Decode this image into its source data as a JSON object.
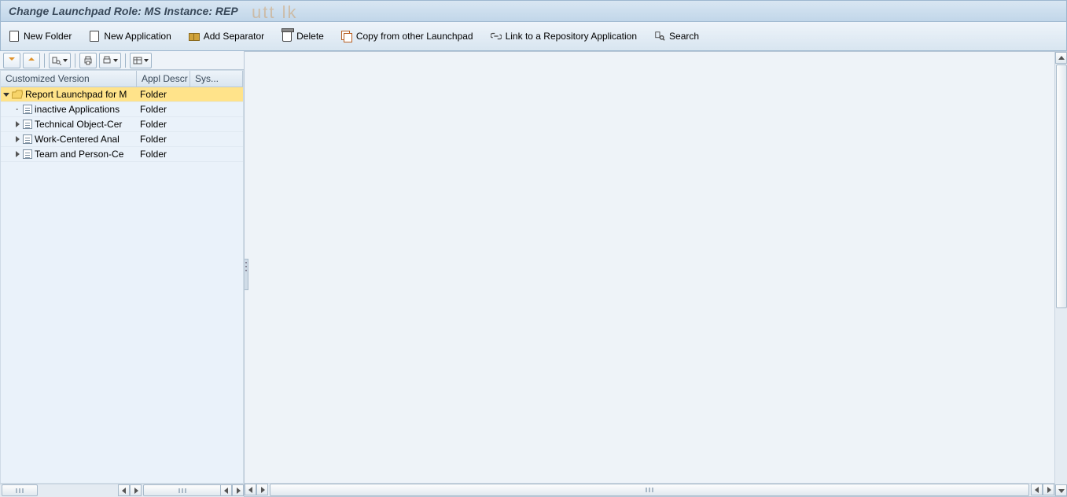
{
  "title": "Change Launchpad Role: MS Instance: REP",
  "toolbar": {
    "newFolder": "New Folder",
    "newApplication": "New Application",
    "addSeparator": "Add Separator",
    "delete": "Delete",
    "copyFrom": "Copy from other Launchpad",
    "linkRepo": "Link to a Repository Application",
    "search": "Search"
  },
  "treeHeaders": {
    "col1": "Customized Version",
    "col2": "Appl Descr",
    "col3": "Sys..."
  },
  "tree": {
    "root": {
      "label": "Report Launchpad for M",
      "type": "Folder"
    },
    "children": [
      {
        "label": "inactive Applications",
        "type": "Folder",
        "expandable": false
      },
      {
        "label": "Technical Object-Cer",
        "type": "Folder",
        "expandable": true
      },
      {
        "label": "Work-Centered Anal",
        "type": "Folder",
        "expandable": true
      },
      {
        "label": "Team and Person-Ce",
        "type": "Folder",
        "expandable": true
      }
    ]
  },
  "watermark": "utt    lk"
}
